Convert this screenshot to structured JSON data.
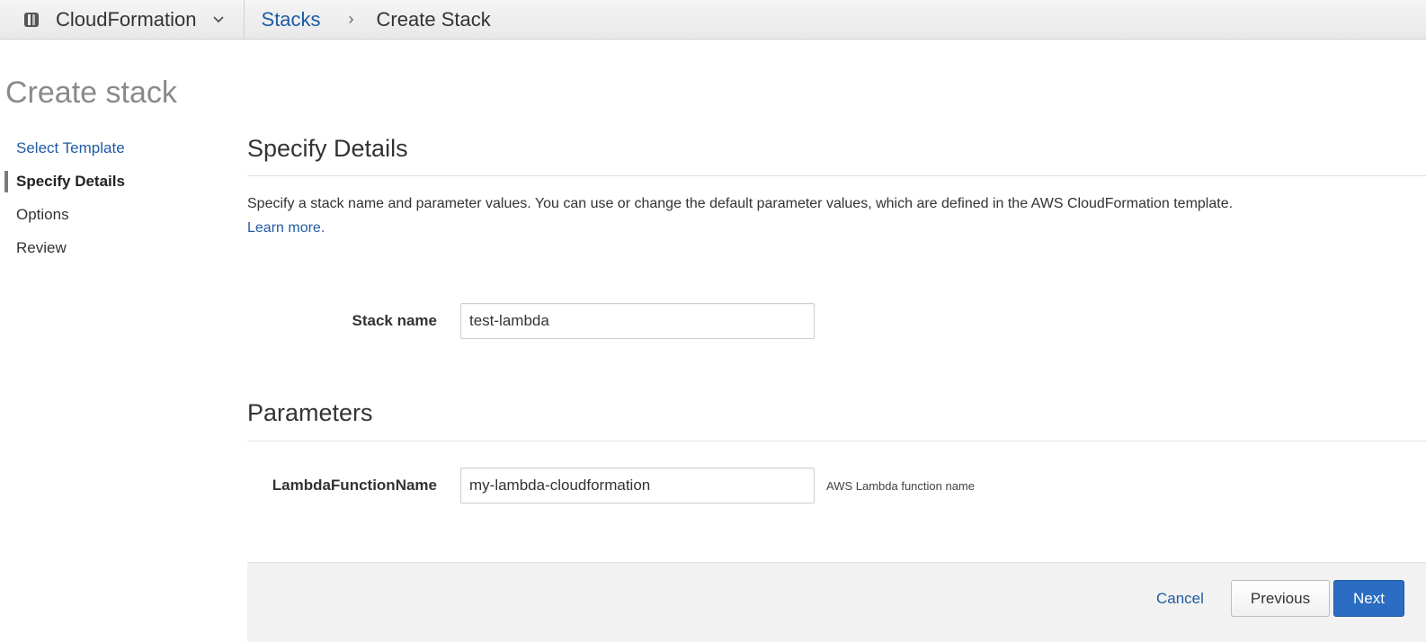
{
  "topbar": {
    "service_name": "CloudFormation",
    "breadcrumb": {
      "link": "Stacks",
      "separator": "›",
      "current": "Create Stack"
    },
    "icons": {
      "service": "cloudformation-icon",
      "dropdown": "chevron-down-icon"
    }
  },
  "page": {
    "title": "Create stack"
  },
  "sidebar": {
    "items": [
      {
        "label": "Select Template",
        "state": "link"
      },
      {
        "label": "Specify Details",
        "state": "active"
      },
      {
        "label": "Options",
        "state": "plain"
      },
      {
        "label": "Review",
        "state": "plain"
      }
    ]
  },
  "details": {
    "title": "Specify Details",
    "description": "Specify a stack name and parameter values. You can use or change the default parameter values, which are defined in the AWS CloudFormation template.",
    "learn_more": "Learn more.",
    "stack_name_label": "Stack name",
    "stack_name_value": "test-lambda"
  },
  "parameters": {
    "title": "Parameters",
    "items": [
      {
        "label": "LambdaFunctionName",
        "value": "my-lambda-cloudformation",
        "hint": "AWS Lambda function name"
      }
    ]
  },
  "footer": {
    "cancel_label": "Cancel",
    "previous_label": "Previous",
    "next_label": "Next"
  },
  "colors": {
    "link": "#1f5ba3",
    "primary_button": "#2a6dc2",
    "title_gray": "#8a8a8a"
  }
}
